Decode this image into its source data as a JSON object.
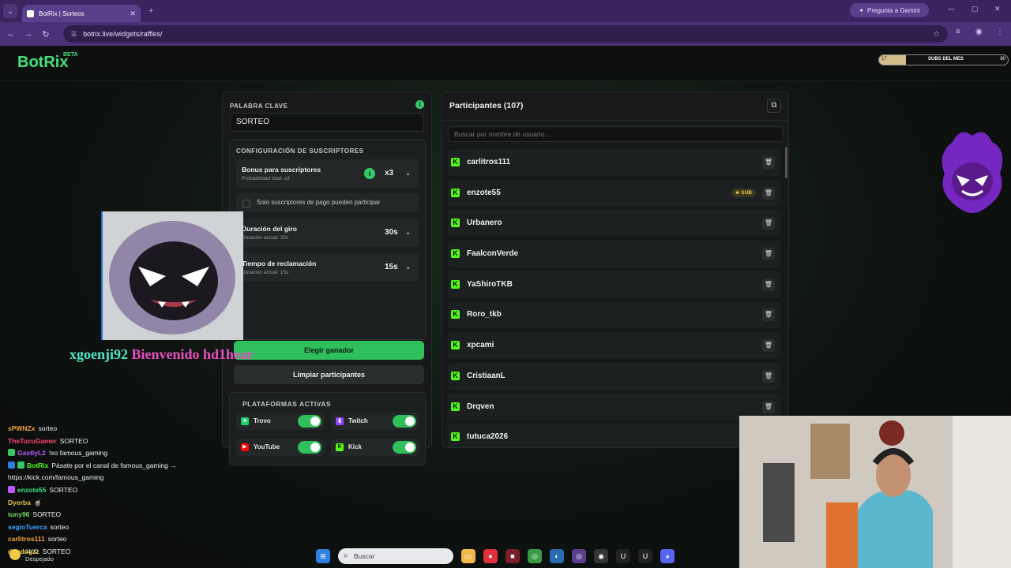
{
  "browser": {
    "tab_title": "BotRix | Sorteos",
    "url": "botrix.live/widgets/raffles/",
    "gemini_label": "Pregunta a Gemini"
  },
  "header": {
    "logo": "BotRix",
    "beta": "BETA",
    "subs_label": "SUBS DEL MES",
    "subs_left": "17",
    "subs_right": "80",
    "subs_progress": 0.21
  },
  "config": {
    "keyword_label": "PALABRA CLAVE",
    "keyword_value": "SORTEO",
    "subs_title": "CONFIGURACIÓN DE SUSCRIPTORES",
    "bonus_title": "Bonus para suscriptores",
    "bonus_sub": "Probabilidad total: x3",
    "bonus_value": "x3",
    "paid_only_label": "Solo suscriptores de pago pueden participar",
    "spin_title": "Duración del giro",
    "spin_sub": "Duración actual: 30s",
    "spin_value": "30s",
    "claim_title": "Tiempo de reclamación",
    "claim_sub": "Duración actual: 15s",
    "claim_value": "15s",
    "pick_winner": "Elegir ganador",
    "clear": "Limpiar participantes",
    "platforms_title": "PLATAFORMAS ACTIVAS",
    "platforms": [
      {
        "name": "Trovo",
        "color": "#19d66b",
        "on": true
      },
      {
        "name": "Twitch",
        "color": "#9146ff",
        "on": true
      },
      {
        "name": "YouTube",
        "color": "#ff0000",
        "on": true
      },
      {
        "name": "Kick",
        "color": "#53fc18",
        "on": true
      }
    ]
  },
  "participants": {
    "title": "Participantes (107)",
    "search_placeholder": "Buscar por nombre de usuario...",
    "sub_badge": "★ SUB",
    "items": [
      "carlitros111",
      "enzote55",
      "Urbanero",
      "FaalconVerde",
      "YaShiroTKB",
      "Roro_tkb",
      "xpcami",
      "CristiaanL",
      "Drqven",
      "tutuca2026"
    ]
  },
  "overlay": {
    "user": "xgoenji92",
    "message": "Bienvenido hd1hear"
  },
  "chat": [
    {
      "user": "sPWNZx",
      "color": "#f2a23a",
      "msg": "sorteo"
    },
    {
      "user": "TheTucuGamer",
      "color": "#ff4b6e",
      "msg": "SORTEO"
    },
    {
      "user": "GastlyL2",
      "color": "#c158ff",
      "msg": "!so famous_gaming"
    },
    {
      "user": "BotRix",
      "color": "#53fc18",
      "msg": "Pásate por el canal de famous_gaming →"
    },
    {
      "user": "",
      "color": "#ffffff",
      "msg": "https://kick.com/famous_gaming"
    },
    {
      "user": "enzote55",
      "color": "#3ee07b",
      "msg": "SORTEO"
    },
    {
      "user": "Dyerba",
      "color": "#e3c04a",
      "msg": "🧉"
    },
    {
      "user": "tuny96",
      "color": "#7cd36a",
      "msg": "SORTEO"
    },
    {
      "user": "segioTuerca",
      "color": "#3da4ff",
      "msg": "sorteo"
    },
    {
      "user": "carlitros111",
      "color": "#f2a23a",
      "msg": "sorteo"
    },
    {
      "user": "dogdogzz",
      "color": "#ffd84a",
      "msg": "SORTEO"
    }
  ],
  "taskbar": {
    "search": "Buscar",
    "weather_temp": "11°C",
    "weather_text": "Despejado"
  }
}
